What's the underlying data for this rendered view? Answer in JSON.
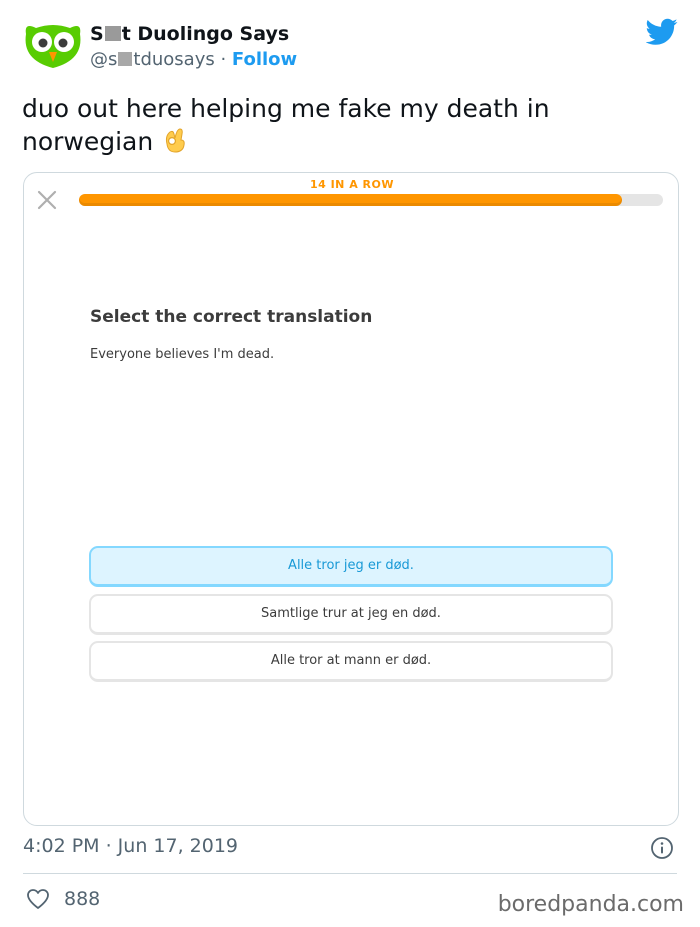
{
  "tweet": {
    "display_name_part1": "S",
    "display_name_part2": "t Duolingo Says",
    "handle_part1": "@s",
    "handle_part2": "tduosays",
    "separator": " · ",
    "follow_label": "Follow",
    "text": "duo out here helping me fake my death in norwegian",
    "emoji_icon": "ok-hand-icon",
    "timestamp": "4:02 PM · Jun 17, 2019",
    "likes": "888",
    "colors": {
      "link": "#1d9bf0",
      "muted": "#536471",
      "text": "#0f1419"
    }
  },
  "lesson": {
    "streak_label": "14 IN A ROW",
    "progress": 0.93,
    "prompt_title": "Select the correct translation",
    "prompt_sentence": "Everyone believes I'm dead.",
    "choices": [
      {
        "label": "Alle tror jeg er død.",
        "selected": true
      },
      {
        "label": "Samtlige trur at jeg en død.",
        "selected": false
      },
      {
        "label": "Alle tror at mann er død.",
        "selected": false
      }
    ],
    "colors": {
      "accent": "#ff9600",
      "selected_bg": "#ddf4ff",
      "selected_border": "#84d8ff",
      "selected_text": "#1899d6"
    }
  },
  "watermark": "boredpanda.com"
}
